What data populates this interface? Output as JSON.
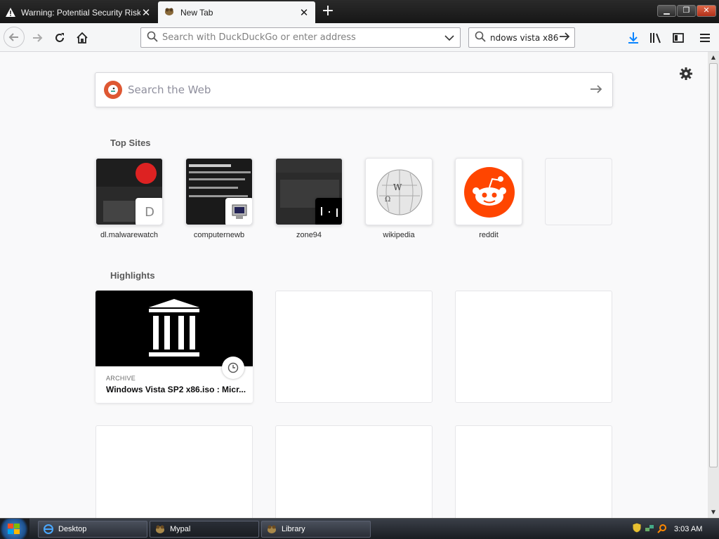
{
  "tabs": [
    {
      "title": "Warning: Potential Security Risk Ahead",
      "icon": "warning-icon",
      "active": false
    },
    {
      "title": "New Tab",
      "icon": "firefox-favicon-icon",
      "active": true
    }
  ],
  "toolbar": {
    "url_placeholder": "Search with DuckDuckGo or enter address",
    "search_value": "ndows vista x86"
  },
  "newtab": {
    "web_search_placeholder": "Search the Web",
    "top_sites_title": "Top Sites",
    "top_sites": [
      {
        "label": "dl.malwarewatch",
        "badge": "D"
      },
      {
        "label": "computernewb",
        "badge": ""
      },
      {
        "label": "zone94",
        "badge": ""
      },
      {
        "label": "wikipedia",
        "badge": ""
      },
      {
        "label": "reddit",
        "badge": ""
      },
      {
        "label": "",
        "badge": ""
      }
    ],
    "highlights_title": "Highlights",
    "highlight": {
      "source": "ARCHIVE",
      "title": "Windows Vista SP2 x86.iso : Micr..."
    }
  },
  "taskbar": {
    "items": [
      "Desktop",
      "Mypal",
      "Library"
    ],
    "clock": "3:03 AM"
  },
  "colors": {
    "accent": "#0a84ff",
    "reddit": "#ff4500",
    "ddg": "#de5833"
  }
}
